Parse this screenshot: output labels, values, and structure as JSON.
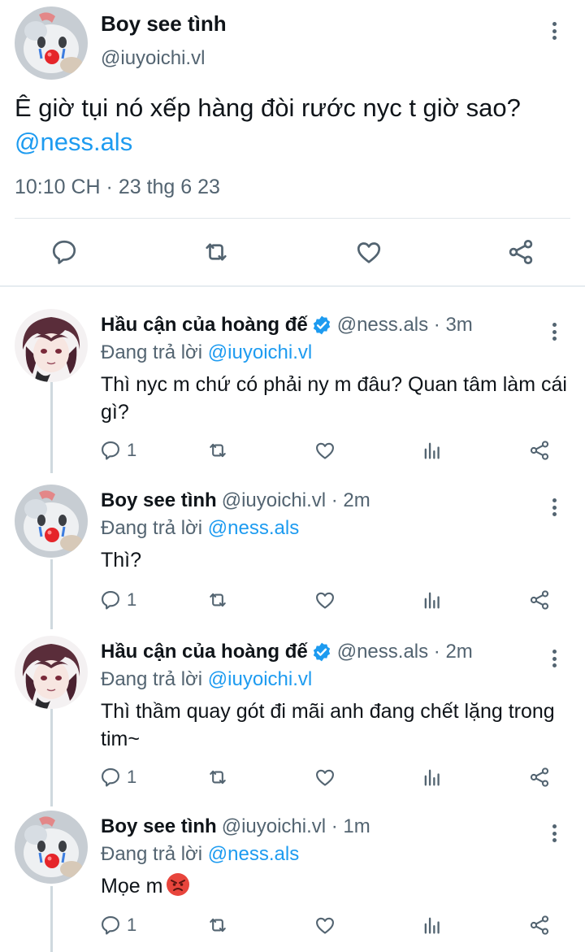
{
  "main_tweet": {
    "author_name": "Boy see tình",
    "author_handle": "@iuyoichi.vl",
    "text": "Ê giờ tụi nó xếp hàng đòi rước nyc t giờ sao?",
    "mention": "@ness.als",
    "timestamp": "10:10 CH · 23 thg 6 23",
    "actions": [
      "reply-icon",
      "retweet-icon",
      "like-icon",
      "share-icon"
    ]
  },
  "replies": [
    {
      "author_name": "Hầu cận của hoàng đế",
      "verified": true,
      "handle_time": "@ness.als · 3m",
      "replying_label": "Đang trả lời",
      "replying_to": "@iuyoichi.vl",
      "text": "Thì nyc m chứ có phải ny m đâu? Quan tâm làm cái gì?",
      "reply_count": "1"
    },
    {
      "author_name": "Boy see tình",
      "verified": false,
      "handle_time": "@iuyoichi.vl · 2m",
      "replying_label": "Đang trả lời",
      "replying_to": "@ness.als",
      "text": "Thì?",
      "reply_count": "1"
    },
    {
      "author_name": "Hầu cận của hoàng đế",
      "verified": true,
      "handle_time": "@ness.als · 2m",
      "replying_label": "Đang trả lời",
      "replying_to": "@iuyoichi.vl",
      "text": "Thì thầm quay gót đi mãi anh đang chết lặng trong tim~",
      "reply_count": "1"
    },
    {
      "author_name": "Boy see tình",
      "verified": false,
      "handle_time": "@iuyoichi.vl · 1m",
      "replying_label": "Đang trả lời",
      "replying_to": "@ness.als",
      "text": "Mọe m",
      "emoji": "angry-face-icon",
      "reply_count": "1"
    }
  ],
  "colors": {
    "link": "#1d9bf0",
    "secondary_text": "#536471",
    "primary_text": "#0f1419",
    "divider": "#e1e6ea"
  }
}
